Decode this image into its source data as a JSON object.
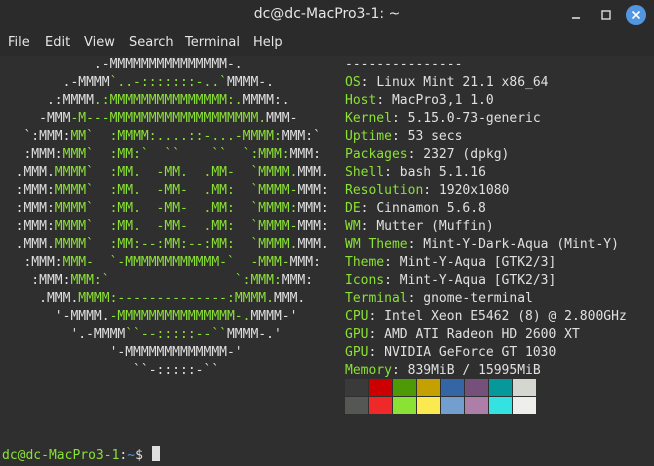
{
  "window": {
    "title": "dc@dc-MacPro3-1: ~"
  },
  "menu": [
    "File",
    "Edit",
    "View",
    "Search",
    "Terminal",
    "Help"
  ],
  "logo": [
    [
      [
        "w",
        "            .-MMMMMMMMMMMMMMM-."
      ]
    ],
    [
      [
        "w",
        "        .-MMMM"
      ],
      [
        "g",
        "`..-:::::::-..`"
      ],
      [
        "w",
        "MMMM-."
      ]
    ],
    [
      [
        "w",
        "      .:MMMM"
      ],
      [
        "g",
        ".:MMMMMMMMMMMMMMM:."
      ],
      [
        "w",
        "MMMM:."
      ]
    ],
    [
      [
        "w",
        "     -MMM"
      ],
      [
        "g",
        "-M---MMMMMMMMMMMMMMMMMMM."
      ],
      [
        "w",
        "MMM-"
      ]
    ],
    [
      [
        "w",
        "   `:MMM:"
      ],
      [
        "g",
        "MM`  :MMMM:....::-...-MMMM:"
      ],
      [
        "w",
        "MMM:`"
      ]
    ],
    [
      [
        "w",
        "   :MMM:"
      ],
      [
        "g",
        "MMM`  :MM:`  ``    ``  `:MMM:"
      ],
      [
        "w",
        "MMM:"
      ]
    ],
    [
      [
        "w",
        "  .MMM."
      ],
      [
        "g",
        "MMMM`  :MM.  -MM.  .MM-  `MMMM."
      ],
      [
        "w",
        "MMM."
      ]
    ],
    [
      [
        "w",
        "  :MMM:"
      ],
      [
        "g",
        "MMMM`  :MM.  -MM-  .MM:  `MMMM-"
      ],
      [
        "w",
        "MMM:"
      ]
    ],
    [
      [
        "w",
        "  :MMM:"
      ],
      [
        "g",
        "MMMM`  :MM.  -MM-  .MM:  `MMMM:"
      ],
      [
        "w",
        "MMM:"
      ]
    ],
    [
      [
        "w",
        "  :MMM:"
      ],
      [
        "g",
        "MMMM`  :MM.  -MM-  .MM:  `MMMM-"
      ],
      [
        "w",
        "MMM:"
      ]
    ],
    [
      [
        "w",
        "  .MMM."
      ],
      [
        "g",
        "MMMM`  :MM:--:MM:--:MM:  `MMMM."
      ],
      [
        "w",
        "MMM."
      ]
    ],
    [
      [
        "w",
        "   :MMM:"
      ],
      [
        "g",
        "MMM-  `-MMMMMMMMMMMM-`  -MMM-"
      ],
      [
        "w",
        "MMM:"
      ]
    ],
    [
      [
        "w",
        "    :MMM:"
      ],
      [
        "g",
        "MMM:`                `:MMM:"
      ],
      [
        "w",
        "MMM:"
      ]
    ],
    [
      [
        "w",
        "     .MMM."
      ],
      [
        "g",
        "MMMM:--------------:MMMM."
      ],
      [
        "w",
        "MMM."
      ]
    ],
    [
      [
        "w",
        "       '-MMMM."
      ],
      [
        "g",
        "-MMMMMMMMMMMMMMM-."
      ],
      [
        "w",
        "MMMM-'"
      ]
    ],
    [
      [
        "w",
        "         '.-MMMM"
      ],
      [
        "g",
        "``--:::::--``"
      ],
      [
        "w",
        "MMMM-.'"
      ]
    ],
    [
      [
        "w",
        "              '-MMMMMMMMMMMMM-'"
      ]
    ],
    [
      [
        "w",
        "                 ``-:::::-``"
      ]
    ]
  ],
  "info_separator": "---------------",
  "info": [
    {
      "label": "OS",
      "value": "Linux Mint 21.1 x86_64"
    },
    {
      "label": "Host",
      "value": "MacPro3,1 1.0"
    },
    {
      "label": "Kernel",
      "value": "5.15.0-73-generic"
    },
    {
      "label": "Uptime",
      "value": "53 secs"
    },
    {
      "label": "Packages",
      "value": "2327 (dpkg)"
    },
    {
      "label": "Shell",
      "value": "bash 5.1.16"
    },
    {
      "label": "Resolution",
      "value": "1920x1080"
    },
    {
      "label": "DE",
      "value": "Cinnamon 5.6.8"
    },
    {
      "label": "WM",
      "value": "Mutter (Muffin)"
    },
    {
      "label": "WM Theme",
      "value": "Mint-Y-Dark-Aqua (Mint-Y)"
    },
    {
      "label": "Theme",
      "value": "Mint-Y-Aqua [GTK2/3]"
    },
    {
      "label": "Icons",
      "value": "Mint-Y-Aqua [GTK2/3]"
    },
    {
      "label": "Terminal",
      "value": "gnome-terminal"
    },
    {
      "label": "CPU",
      "value": "Intel Xeon E5462 (8) @ 2.800GHz"
    },
    {
      "label": "GPU",
      "value": "AMD ATI Radeon HD 2600 XT"
    },
    {
      "label": "GPU",
      "value": "NVIDIA GeForce GT 1030"
    },
    {
      "label": "Memory",
      "value": "839MiB / 15995MiB"
    }
  ],
  "palette_top": [
    "#3a3a3a",
    "#cc0000",
    "#4e9a06",
    "#c4a000",
    "#3465a4",
    "#75507b",
    "#06989a",
    "#d3d7cf"
  ],
  "palette_bottom": [
    "#555753",
    "#ef2929",
    "#8ae234",
    "#fce94f",
    "#729fcf",
    "#ad7fa8",
    "#34e2e2",
    "#eeeeec"
  ],
  "prompt": {
    "user_host": "dc@dc-MacPro3-1",
    "sep": ":",
    "path": "~",
    "symbol": "$"
  }
}
